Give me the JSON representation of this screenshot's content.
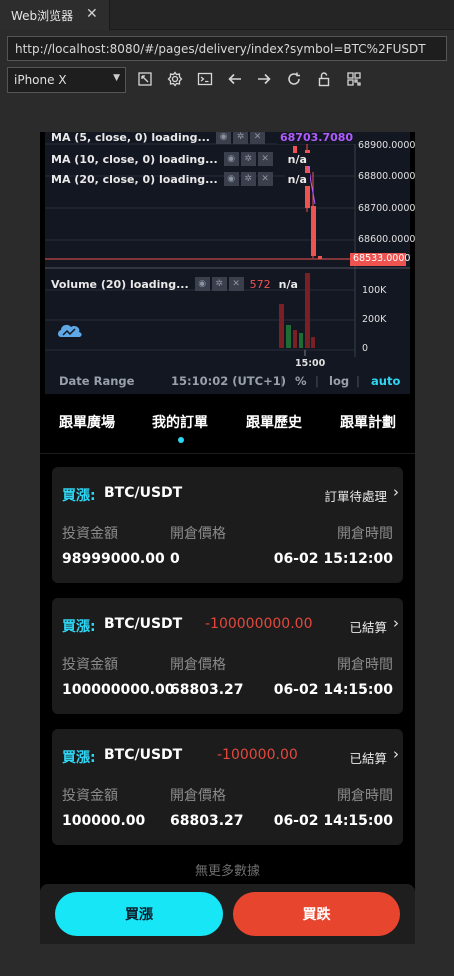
{
  "ide": {
    "tab_title": "Web浏览器",
    "tab_close": "✕",
    "url": "http://localhost:8080/#/pages/delivery/index?symbol=BTC%2FUSDT",
    "device": "iPhone X",
    "tool_icons": [
      "rotate-icon",
      "settings-icon",
      "terminal-icon",
      "back-icon",
      "forward-icon",
      "refresh-icon",
      "unlock-icon",
      "qrcode-icon"
    ]
  },
  "chart": {
    "indicators": [
      {
        "label": "MA (5, close, 0) loading...",
        "value": "68703.7080",
        "value_color": "#b05cff"
      },
      {
        "label": "MA (10, close, 0) loading...",
        "value": "n/a",
        "value_color": "#ffffff"
      },
      {
        "label": "MA (20, close, 0) loading...",
        "value": "n/a",
        "value_color": "#ffffff"
      }
    ],
    "volume_indicator": {
      "label": "Volume (20) loading...",
      "value_red": "572",
      "value": "n/a"
    },
    "price_axis": [
      "68900.0000",
      "68800.0000",
      "68700.0000",
      "68600.0000"
    ],
    "last_price": "68533.0000",
    "volume_axis": [
      "100K",
      "200K",
      "0"
    ],
    "time_label": "15:00",
    "footer": {
      "date_range": "Date Range",
      "time": "15:10:02 (UTC+1)",
      "percent": "%",
      "log": "log",
      "auto": "auto"
    },
    "colors": {
      "bg": "#131722",
      "down": "#ef5350",
      "up": "#26a69a",
      "accent": "#2fd6f4"
    }
  },
  "tabs": [
    {
      "label": "跟單廣場"
    },
    {
      "label": "我的訂單"
    },
    {
      "label": "跟單歷史"
    },
    {
      "label": "跟單計劃"
    }
  ],
  "orders": [
    {
      "side": "買漲:",
      "symbol": "BTC/USDT",
      "pnl": "",
      "status": "訂單待處理",
      "labels": [
        "投資金額",
        "開倉價格",
        "開倉時間"
      ],
      "amount": "98999000.00",
      "open_price": "0",
      "open_time": "06-02 15:12:00"
    },
    {
      "side": "買漲:",
      "symbol": "BTC/USDT",
      "pnl": "-100000000.00",
      "status": "已結算",
      "labels": [
        "投資金額",
        "開倉價格",
        "開倉時間"
      ],
      "amount": "100000000.00",
      "open_price": "68803.27",
      "open_time": "06-02 14:15:00"
    },
    {
      "side": "買漲:",
      "symbol": "BTC/USDT",
      "pnl": "-100000.00",
      "status": "已結算",
      "labels": [
        "投資金額",
        "開倉價格",
        "開倉時間"
      ],
      "amount": "100000.00",
      "open_price": "68803.27",
      "open_time": "06-02 14:15:00"
    }
  ],
  "no_more": "無更多數據",
  "actions": {
    "buy": "買漲",
    "sell": "買跌"
  }
}
